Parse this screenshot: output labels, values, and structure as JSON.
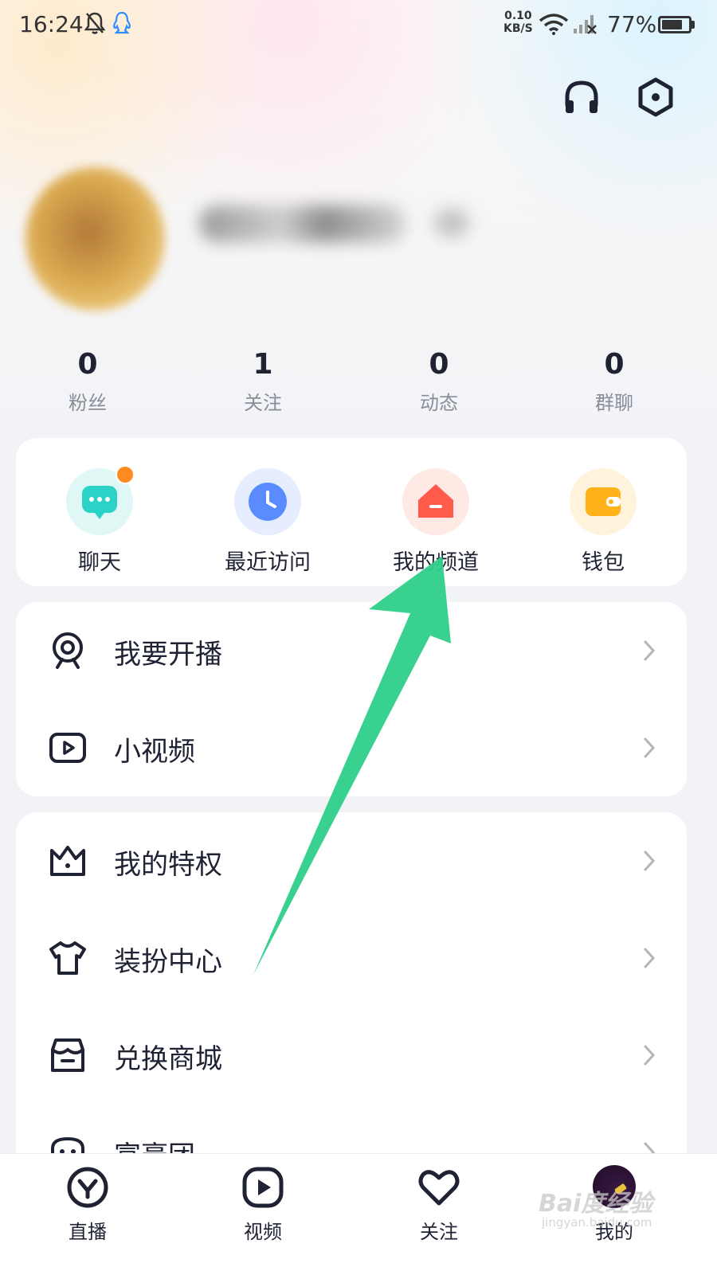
{
  "status_bar": {
    "time": "16:24",
    "net_speed_value": "0.10",
    "net_speed_unit": "KB/S",
    "battery": "77%",
    "battery_level": 0.77,
    "icons": [
      "mute-bell-icon",
      "qq-penguin-icon",
      "wifi-icon",
      "no-signal-icon",
      "battery-icon"
    ]
  },
  "header": {
    "actions": [
      "headphones-icon",
      "settings-hexagon-icon"
    ]
  },
  "stats": [
    {
      "value": "0",
      "label": "粉丝"
    },
    {
      "value": "1",
      "label": "关注"
    },
    {
      "value": "0",
      "label": "动态"
    },
    {
      "value": "0",
      "label": "群聊"
    }
  ],
  "quick_actions": [
    {
      "label": "聊天",
      "icon": "chat-bubble-icon",
      "color": "#2ad3c6",
      "bg": "#dff8f6",
      "has_dot": true
    },
    {
      "label": "最近访问",
      "icon": "clock-icon",
      "color": "#5b8cff",
      "bg": "#e5edff"
    },
    {
      "label": "我的频道",
      "icon": "house-icon",
      "color": "#ff5a4a",
      "bg": "#ffe9e5"
    },
    {
      "label": "钱包",
      "icon": "wallet-icon",
      "color": "#ffb21a",
      "bg": "#fff3dc"
    }
  ],
  "menu_group_1": [
    {
      "label": "我要开播",
      "icon": "webcam-icon"
    },
    {
      "label": "小视频",
      "icon": "video-play-icon"
    }
  ],
  "menu_group_2": [
    {
      "label": "我的特权",
      "icon": "crown-icon"
    },
    {
      "label": "装扮中心",
      "icon": "shirt-icon"
    },
    {
      "label": "兑换商城",
      "icon": "store-icon"
    },
    {
      "label": "富豪团",
      "icon": "group-icon"
    }
  ],
  "bottom_nav": [
    {
      "label": "直播",
      "icon": "live-icon"
    },
    {
      "label": "视频",
      "icon": "video-icon"
    },
    {
      "label": "关注",
      "icon": "heart-icon"
    },
    {
      "label": "我的",
      "icon": "profile-avatar"
    }
  ],
  "watermark": {
    "text": "Bai度经验",
    "sub": "jingyan.baidu.com"
  },
  "colors": {
    "accent_arrow": "#2ecf8a",
    "text_primary": "#1e2233",
    "text_secondary": "#8a8d99"
  }
}
